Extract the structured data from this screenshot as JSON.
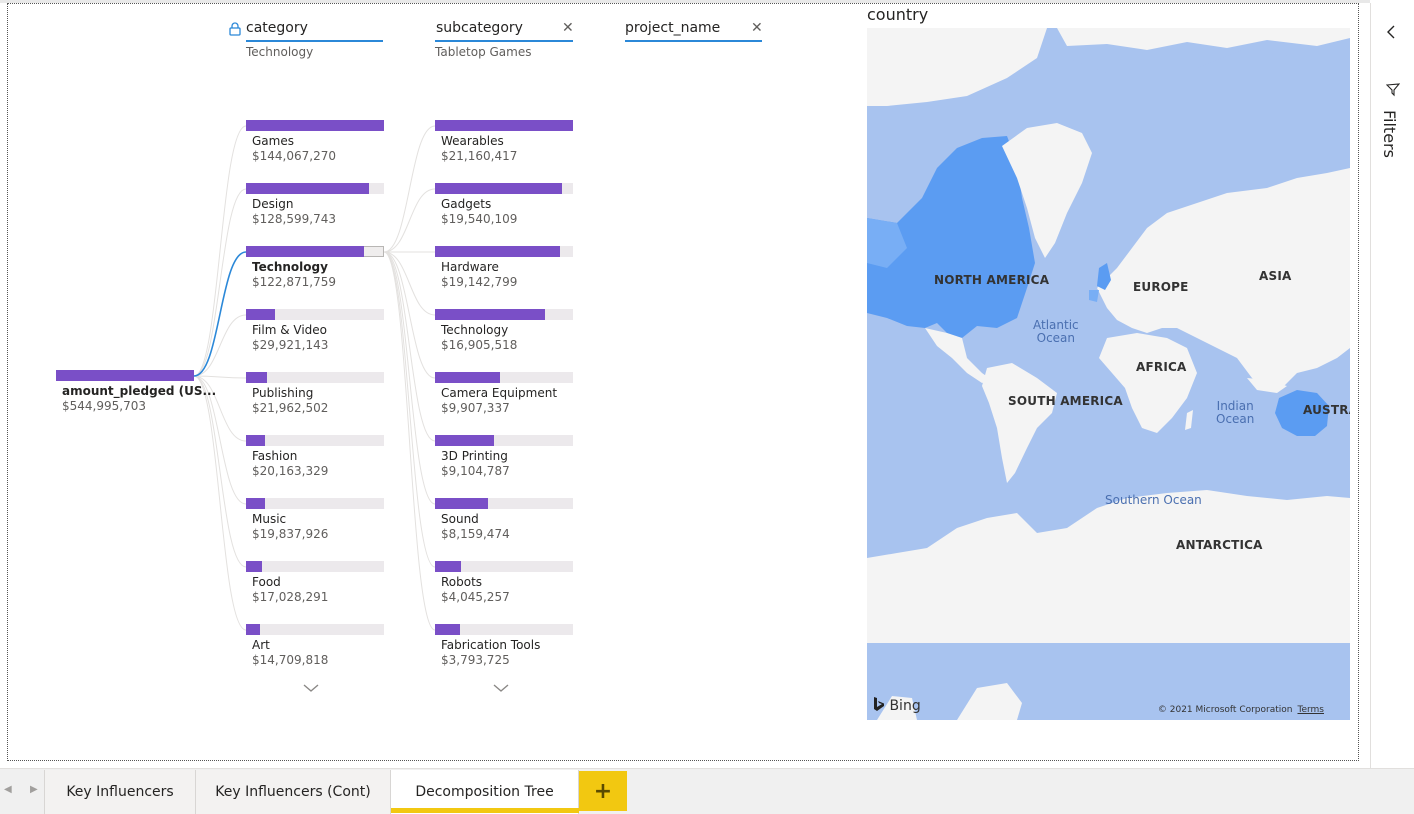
{
  "tree": {
    "levels": [
      {
        "title": "category",
        "selected": "Technology",
        "locked": true,
        "closable": false
      },
      {
        "title": "subcategory",
        "selected": "Tabletop Games",
        "locked": false,
        "closable": true
      },
      {
        "title": "project_name",
        "selected": "",
        "locked": false,
        "closable": true
      }
    ],
    "root": {
      "name": "amount_pledged (US...",
      "value": "$544,995,703",
      "fraction": 1.0
    },
    "categories": [
      {
        "name": "Games",
        "value": "$144,067,270",
        "fraction": 1.0
      },
      {
        "name": "Design",
        "value": "$128,599,743",
        "fraction": 0.893
      },
      {
        "name": "Technology",
        "value": "$122,871,759",
        "fraction": 0.853,
        "selected": true
      },
      {
        "name": "Film & Video",
        "value": "$29,921,143",
        "fraction": 0.208
      },
      {
        "name": "Publishing",
        "value": "$21,962,502",
        "fraction": 0.152
      },
      {
        "name": "Fashion",
        "value": "$20,163,329",
        "fraction": 0.14
      },
      {
        "name": "Music",
        "value": "$19,837,926",
        "fraction": 0.138
      },
      {
        "name": "Food",
        "value": "$17,028,291",
        "fraction": 0.118
      },
      {
        "name": "Art",
        "value": "$14,709,818",
        "fraction": 0.102
      }
    ],
    "subcategories": [
      {
        "name": "Wearables",
        "value": "$21,160,417",
        "fraction": 1.0
      },
      {
        "name": "Gadgets",
        "value": "$19,540,109",
        "fraction": 0.923
      },
      {
        "name": "Hardware",
        "value": "$19,142,799",
        "fraction": 0.905
      },
      {
        "name": "Technology",
        "value": "$16,905,518",
        "fraction": 0.799
      },
      {
        "name": "Camera Equipment",
        "value": "$9,907,337",
        "fraction": 0.468
      },
      {
        "name": "3D Printing",
        "value": "$9,104,787",
        "fraction": 0.43
      },
      {
        "name": "Sound",
        "value": "$8,159,474",
        "fraction": 0.386
      },
      {
        "name": "Robots",
        "value": "$4,045,257",
        "fraction": 0.191
      },
      {
        "name": "Fabrication Tools",
        "value": "$3,793,725",
        "fraction": 0.179
      }
    ]
  },
  "map": {
    "title": "country",
    "labels": {
      "north_america": "NORTH AMERICA",
      "europe": "EUROPE",
      "asia": "ASIA",
      "africa": "AFRICA",
      "south_america": "SOUTH AMERICA",
      "australia": "AUSTRA",
      "antarctica": "ANTARCTICA"
    },
    "oceans": {
      "atlantic": "Atlantic\nOcean",
      "indian": "Indian\nOcean",
      "southern": "Southern Ocean"
    },
    "bing": "Bing",
    "copyright": "© 2021 Microsoft Corporation",
    "terms": "Terms",
    "colors": {
      "water": "#a8c3ef",
      "land": "#f4f4f4",
      "highlight": "#5b9cf2"
    }
  },
  "filters": {
    "label": "Filters"
  },
  "tabs": [
    {
      "label": "Key Influencers",
      "active": false
    },
    {
      "label": "Key Influencers (Cont)",
      "active": false
    },
    {
      "label": "Decomposition Tree",
      "active": true
    }
  ],
  "add_tab": "+",
  "colors": {
    "bar": "#7a4fc7",
    "bar_bg": "#ece9ec",
    "accent": "#2b88d8",
    "tab_accent": "#f2c811"
  }
}
